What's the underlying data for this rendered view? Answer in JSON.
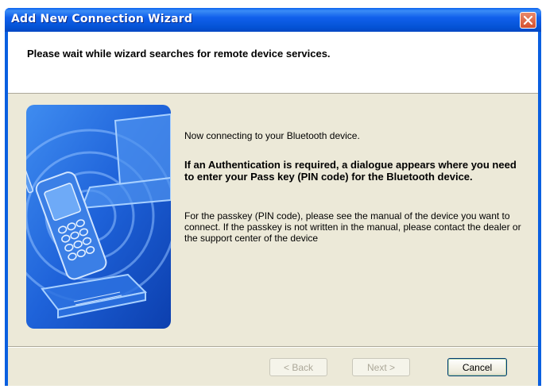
{
  "window": {
    "title": "Add New Connection Wizard"
  },
  "header": {
    "title": "Please wait while wizard searches for remote device services."
  },
  "content": {
    "status": "Now connecting to your Bluetooth device.",
    "auth_notice": "If an Authentication is required, a dialogue appears where you need to enter your Pass key (PIN code) for the Bluetooth device.",
    "passkey_help": "For the passkey (PIN code), please see the manual of the device you want to connect. If the passkey is not written in the manual, please contact the dealer or the support center of the device"
  },
  "buttons": {
    "back": "< Back",
    "next": "Next >",
    "cancel": "Cancel"
  },
  "colors": {
    "titlebar": "#0a5fe0",
    "dialog_bg": "#ece9d8",
    "art_blue": "#1a5fd8"
  },
  "icons": {
    "close": "close-icon",
    "wizard_art": "bluetooth-phone-laptop-illustration"
  }
}
